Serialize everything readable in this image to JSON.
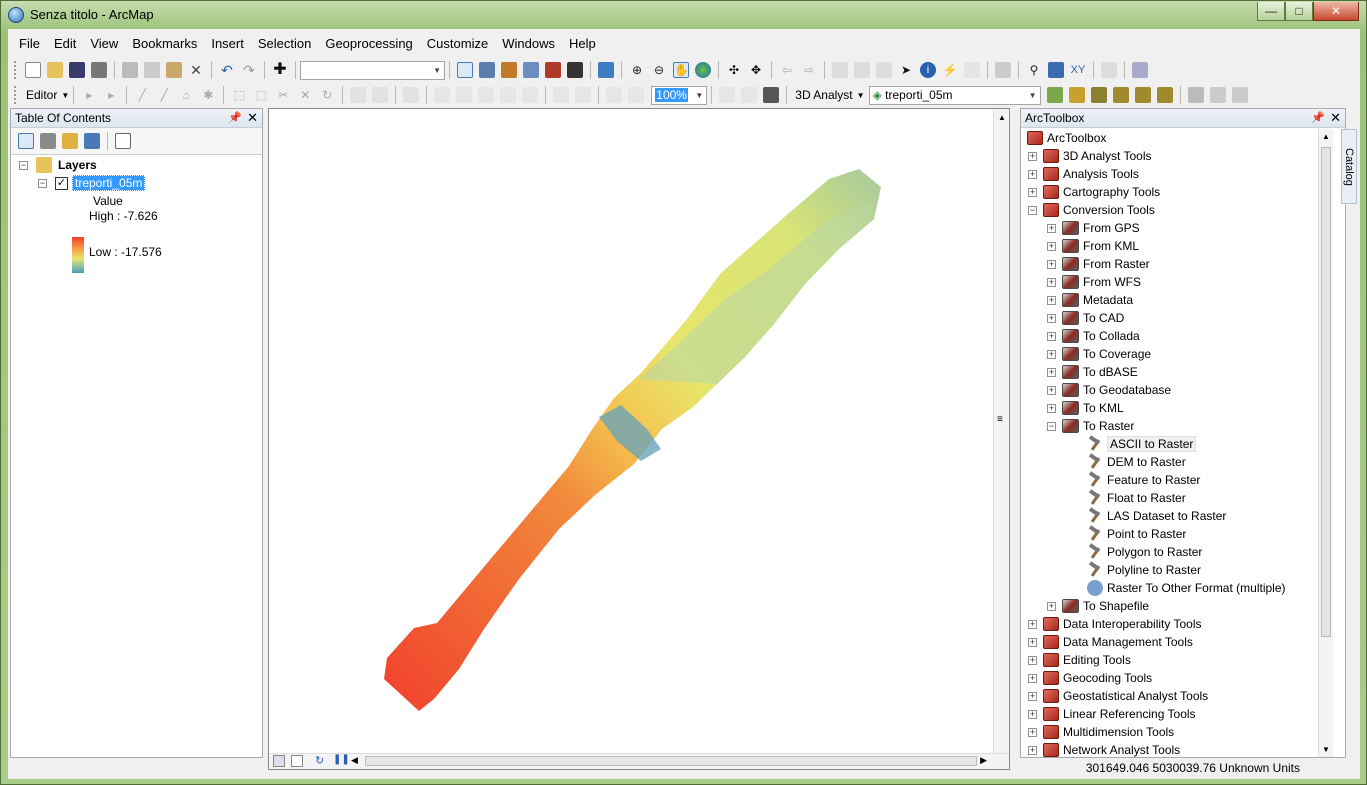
{
  "window": {
    "title": "Senza titolo - ArcMap",
    "min": "—",
    "max": "□",
    "close": "✕"
  },
  "menu": [
    "File",
    "Edit",
    "View",
    "Bookmarks",
    "Insert",
    "Selection",
    "Geoprocessing",
    "Customize",
    "Windows",
    "Help"
  ],
  "toolbar2": {
    "editor_label": "Editor",
    "zoom_value": "100%",
    "analyst_label": "3D Analyst",
    "layer_combo": "treporti_05m"
  },
  "toc": {
    "title": "Table Of Contents",
    "root": "Layers",
    "layer": "treporti_05m",
    "legend_header": "Value",
    "high": "High : -7.626",
    "low": "Low : -17.576"
  },
  "toolbox": {
    "title": "ArcToolbox",
    "root": "ArcToolbox",
    "top": [
      "3D Analyst Tools",
      "Analysis Tools",
      "Cartography Tools",
      "Conversion Tools"
    ],
    "conversion": [
      "From GPS",
      "From KML",
      "From Raster",
      "From WFS",
      "Metadata",
      "To CAD",
      "To Collada",
      "To Coverage",
      "To dBASE",
      "To Geodatabase",
      "To KML",
      "To Raster"
    ],
    "raster_tools": [
      "ASCII to Raster",
      "DEM to Raster",
      "Feature to Raster",
      "Float to Raster",
      "LAS Dataset to Raster",
      "Point to Raster",
      "Polygon to Raster",
      "Polyline to Raster",
      "Raster To Other Format (multiple)"
    ],
    "after": "To Shapefile",
    "bottom": [
      "Data Interoperability Tools",
      "Data Management Tools",
      "Editing Tools",
      "Geocoding Tools",
      "Geostatistical Analyst Tools",
      "Linear Referencing Tools",
      "Multidimension Tools",
      "Network Analyst Tools"
    ]
  },
  "catalog_tab": "Catalog",
  "status": {
    "coords": "301649.046  5030039.76 Unknown Units"
  },
  "colors": {
    "high": "#f1402c",
    "mid": "#e8e56b",
    "low": "#4e9ab8"
  }
}
